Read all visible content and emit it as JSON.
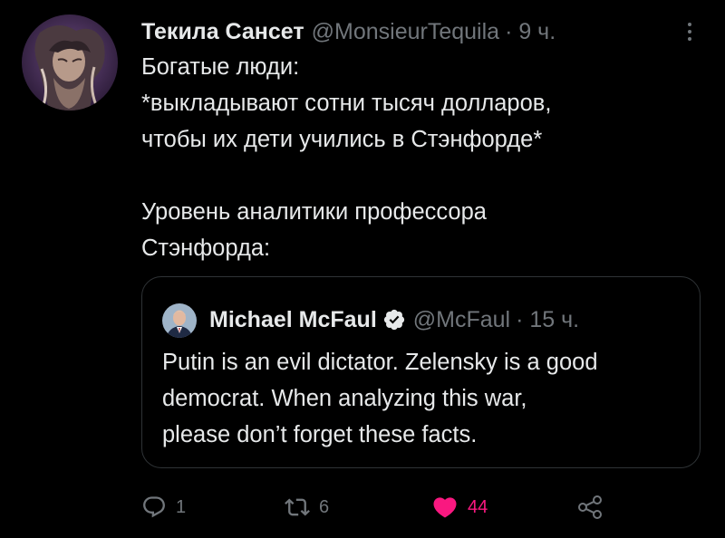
{
  "tweet": {
    "author": {
      "display_name": "Текила Сансет",
      "handle": "@MonsieurTequila",
      "time": "· 9 ч."
    },
    "text_lines": [
      "Богатые люди:",
      "*выкладывают сотни тысяч долларов,",
      "чтобы их дети учились в Стэнфорде*",
      "",
      "Уровень аналитики профессора",
      "Стэнфорда:"
    ],
    "quoted": {
      "display_name": "Michael McFaul",
      "verified": true,
      "handle": "@McFaul",
      "time": "· 15 ч.",
      "text_lines": [
        "Putin is an evil dictator. Zelensky is a good",
        "democrat. When analyzing this war,",
        "please don’t forget these facts."
      ]
    },
    "actions": {
      "replies": "1",
      "retweets": "6",
      "likes": "44",
      "liked": true
    },
    "icons": {
      "reply": "reply-icon",
      "retweet": "retweet-icon",
      "like": "heart-icon",
      "share": "share-icon",
      "more": "more-icon",
      "verified": "verified-badge-icon"
    },
    "colors": {
      "background": "#000000",
      "text": "#e7e9ea",
      "muted": "#71767b",
      "like": "#f91880",
      "verified": "#1d9bf0",
      "border": "#2f3336"
    }
  }
}
